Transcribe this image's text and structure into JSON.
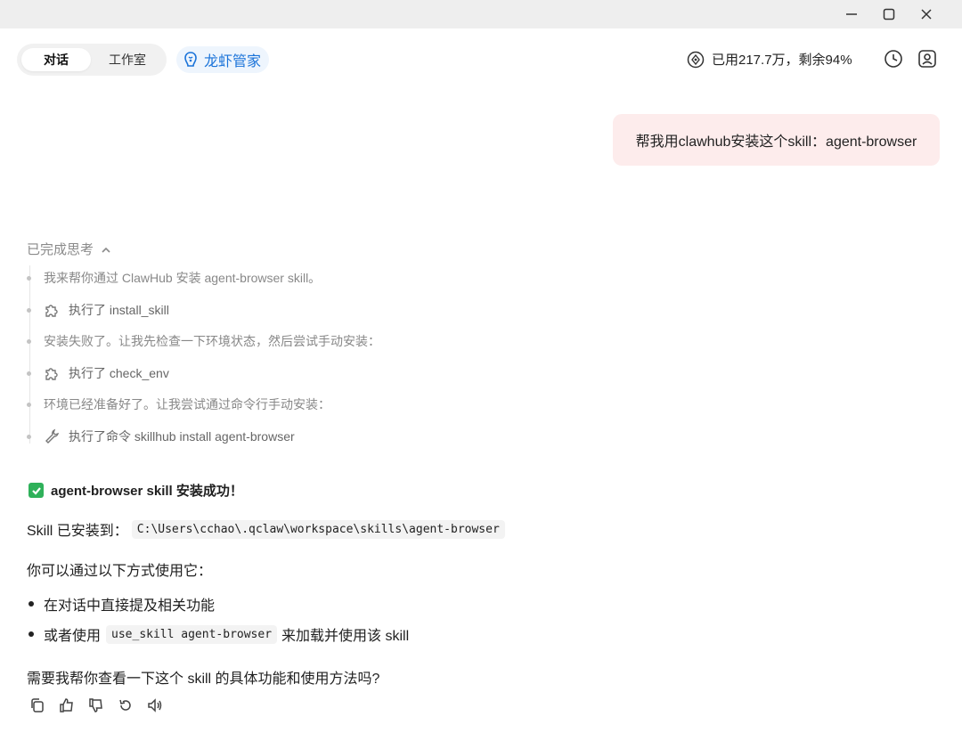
{
  "window": {
    "controls": [
      "minimize-icon",
      "maximize-icon",
      "close-icon"
    ]
  },
  "header": {
    "tabs": [
      {
        "label": "对话",
        "active": true
      },
      {
        "label": "工作室",
        "active": false
      }
    ],
    "manager": {
      "label": "龙虾管家",
      "icon": "lobster-logo-icon",
      "color": "#1a73d9"
    },
    "usage": {
      "text": "已用217.7万，剩余94%",
      "icon": "credit-icon"
    },
    "icons": [
      "history-icon",
      "user-icon"
    ]
  },
  "conversation": {
    "user_message": "帮我用clawhub安装这个skill：agent-browser",
    "thinking": {
      "toggle_label": "已完成思考",
      "expanded": true,
      "steps": [
        {
          "type": "text",
          "text": "我来帮你通过 ClawHub 安装 agent-browser skill。"
        },
        {
          "type": "tool",
          "icon": "puzzle-icon",
          "text": "执行了 install_skill"
        },
        {
          "type": "text",
          "text": "安装失败了。让我先检查一下环境状态，然后尝试手动安装："
        },
        {
          "type": "tool",
          "icon": "puzzle-icon",
          "text": "执行了 check_env"
        },
        {
          "type": "text",
          "text": "环境已经准备好了。让我尝试通过命令行手动安装："
        },
        {
          "type": "tool",
          "icon": "wrench-icon",
          "text": "执行了命令 skillhub install agent-browser"
        }
      ]
    },
    "answer": {
      "success_title": "agent-browser skill 安装成功！",
      "path_label": "Skill 已安装到：",
      "path_value": "C:\\Users\\cchao\\.qclaw\\workspace\\skills\\agent-browser",
      "usage_intro": "你可以通过以下方式使用它：",
      "bullet1": "在对话中直接提及相关功能",
      "bullet2_prefix": "或者使用",
      "bullet2_code": "use_skill agent-browser",
      "bullet2_suffix": "来加载并使用该 skill",
      "question": "需要我帮你查看一下这个 skill 的具体功能和使用方法吗?"
    },
    "actions": [
      "copy-icon",
      "thumbs-up-icon",
      "thumbs-down-icon",
      "regenerate-icon",
      "speaker-icon"
    ]
  },
  "colors": {
    "user_bubble": "#fdecec",
    "success_check": "#2fb15a",
    "accent_blue": "#1a73d9"
  }
}
